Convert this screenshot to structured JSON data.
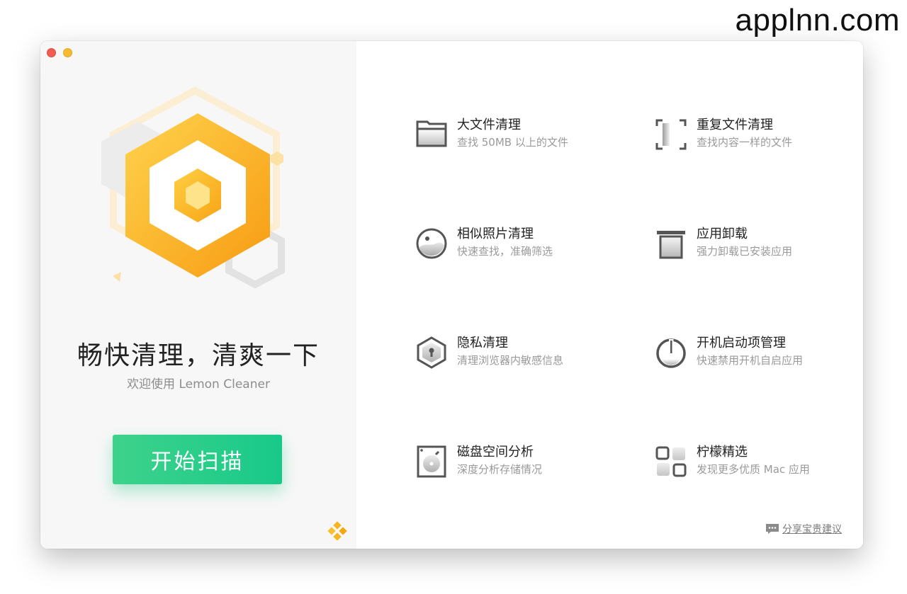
{
  "watermark": "applnn.com",
  "left": {
    "headline": "畅快清理，清爽一下",
    "subline": "欢迎使用 Lemon Cleaner",
    "scan_button": "开始扫描"
  },
  "features": [
    {
      "title": "大文件清理",
      "desc": "查找 50MB 以上的文件",
      "icon": "folder-icon"
    },
    {
      "title": "重复文件清理",
      "desc": "查找内容一样的文件",
      "icon": "duplicate-frame-icon"
    },
    {
      "title": "相似照片清理",
      "desc": "快速查找，准确筛选",
      "icon": "photo-circle-icon"
    },
    {
      "title": "应用卸载",
      "desc": "强力卸载已安装应用",
      "icon": "trash-icon"
    },
    {
      "title": "隐私清理",
      "desc": "清理浏览器内敏感信息",
      "icon": "lock-hexagon-icon"
    },
    {
      "title": "开机启动项管理",
      "desc": "快速禁用开机自启应用",
      "icon": "power-icon"
    },
    {
      "title": "磁盘空间分析",
      "desc": "深度分析存储情况",
      "icon": "disk-icon"
    },
    {
      "title": "柠檬精选",
      "desc": "发现更多优质 Mac 应用",
      "icon": "apps-grid-icon"
    }
  ],
  "feedback": {
    "label": "分享宝贵建议"
  },
  "colors": {
    "accent_green": "#1ec98a",
    "hex_orange": "#f7a716",
    "close_red": "#f25b54",
    "minimize_yellow": "#f6bb32"
  }
}
